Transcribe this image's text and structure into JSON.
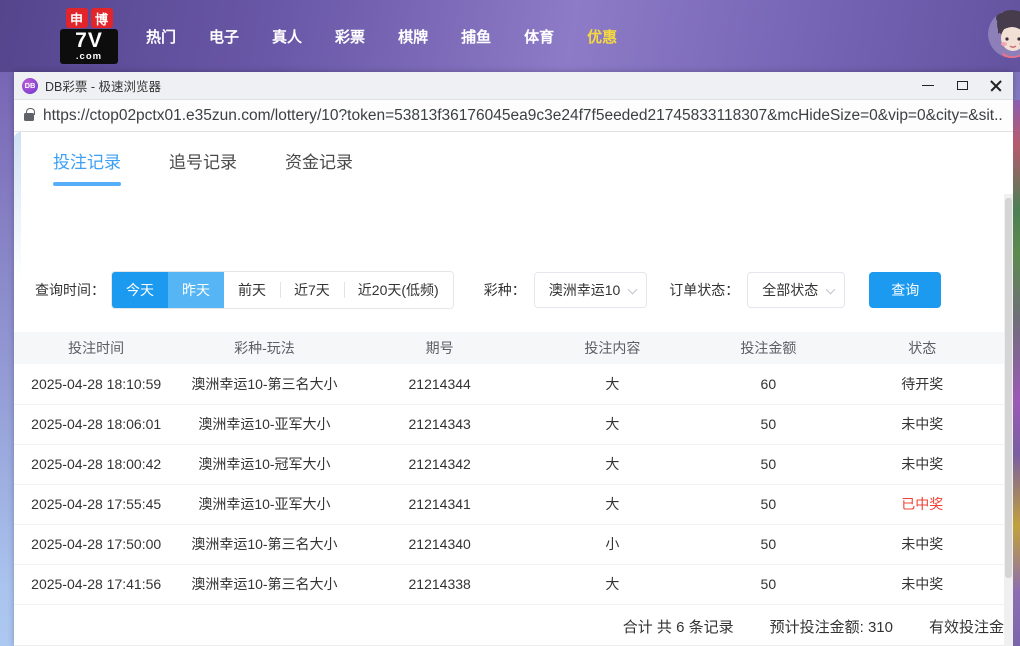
{
  "site_header": {
    "logo": {
      "square_left": "申",
      "square_right": "博",
      "main": "7V",
      "suffix": ".com"
    },
    "nav_items": [
      {
        "label": "热门",
        "class": ""
      },
      {
        "label": "电子",
        "class": ""
      },
      {
        "label": "真人",
        "class": ""
      },
      {
        "label": "彩票",
        "class": ""
      },
      {
        "label": "棋牌",
        "class": ""
      },
      {
        "label": "捕鱼",
        "class": ""
      },
      {
        "label": "体育",
        "class": ""
      },
      {
        "label": "优惠",
        "class": "highlight"
      }
    ]
  },
  "browser": {
    "title": "DB彩票 - 极速浏览器",
    "title_icon_text": "DB",
    "url": "https://ctop02pctx01.e35zun.com/lottery/10?token=53813f36176045ea9c3e24f7f5eeded21745833118307&mcHideSize=0&vip=0&city=&sit...",
    "window_controls": {
      "minimize": "minimize",
      "maximize": "maximize",
      "close": "close"
    }
  },
  "tabs": [
    {
      "label": "投注记录",
      "class": "active"
    },
    {
      "label": "追号记录",
      "class": ""
    },
    {
      "label": "资金记录",
      "class": ""
    }
  ],
  "filters": {
    "time_label": "查询时间：",
    "time_options": [
      {
        "label": "今天"
      },
      {
        "label": "昨天"
      },
      {
        "label": "前天"
      },
      {
        "label": "近7天"
      },
      {
        "label": "近20天(低频)"
      }
    ],
    "lottery_label": "彩种：",
    "lottery_value": "澳洲幸运10",
    "status_label": "订单状态：",
    "status_value": "全部状态",
    "search_button": "查询"
  },
  "table": {
    "columns": [
      "投注时间",
      "彩种-玩法",
      "期号",
      "投注内容",
      "投注金额",
      "状态"
    ],
    "rows": [
      {
        "time": "2025-04-28 18:10:59",
        "play": "澳洲幸运10-第三名大小",
        "issue": "21214344",
        "content": "大",
        "amount": "60",
        "status": "待开奖",
        "status_class": ""
      },
      {
        "time": "2025-04-28 18:06:01",
        "play": "澳洲幸运10-亚军大小",
        "issue": "21214343",
        "content": "大",
        "amount": "50",
        "status": "未中奖",
        "status_class": ""
      },
      {
        "time": "2025-04-28 18:00:42",
        "play": "澳洲幸运10-冠军大小",
        "issue": "21214342",
        "content": "大",
        "amount": "50",
        "status": "未中奖",
        "status_class": ""
      },
      {
        "time": "2025-04-28 17:55:45",
        "play": "澳洲幸运10-亚军大小",
        "issue": "21214341",
        "content": "大",
        "amount": "50",
        "status": "已中奖",
        "status_class": "red"
      },
      {
        "time": "2025-04-28 17:50:00",
        "play": "澳洲幸运10-第三名大小",
        "issue": "21214340",
        "content": "小",
        "amount": "50",
        "status": "未中奖",
        "status_class": ""
      },
      {
        "time": "2025-04-28 17:41:56",
        "play": "澳洲幸运10-第三名大小",
        "issue": "21214338",
        "content": "大",
        "amount": "50",
        "status": "未中奖",
        "status_class": ""
      }
    ],
    "summary": {
      "total_records": "合计 共 6 条记录",
      "expected_amount": "预计投注金额: 310",
      "valid_amount_clipped": "有效投注金"
    }
  },
  "icons": {
    "lock": "padlock",
    "chevron": "chevron-down",
    "minimize": "horizontal-bar",
    "maximize": "square-outline",
    "close": "x-cross"
  },
  "colors": {
    "primary_blue": "#1b9af0",
    "secondary_blue": "#55b5f5",
    "tab_active_blue": "#3da0f6",
    "win_status_red": "#f04134",
    "header_purple_dark": "#55458d",
    "header_purple_light": "#8d7bc7",
    "highlight_yellow": "#f5d93f"
  }
}
